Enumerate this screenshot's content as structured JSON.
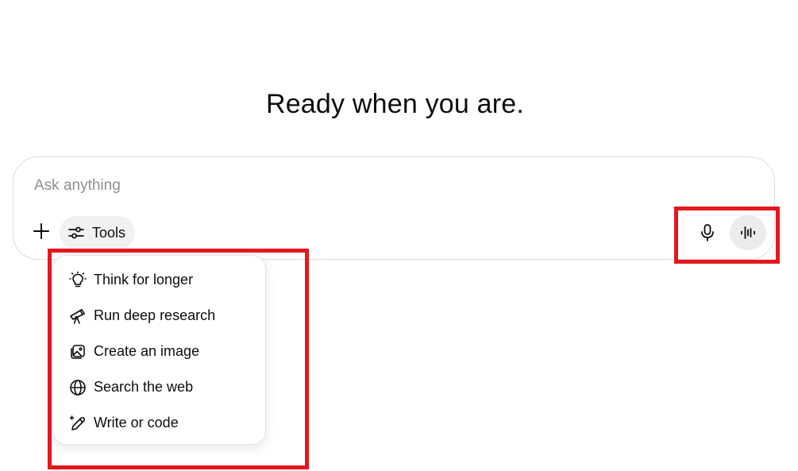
{
  "heading": "Ready when you are.",
  "composer": {
    "placeholder": "Ask anything",
    "value": "",
    "tools_label": "Tools"
  },
  "tools_menu": {
    "items": [
      {
        "label": "Think for longer",
        "icon": "lightbulb-icon"
      },
      {
        "label": "Run deep research",
        "icon": "telescope-icon"
      },
      {
        "label": "Create an image",
        "icon": "image-icon"
      },
      {
        "label": "Search the web",
        "icon": "globe-icon"
      },
      {
        "label": "Write or code",
        "icon": "pencil-sparkle-icon"
      }
    ]
  },
  "colors": {
    "highlight": "#e3181d",
    "text": "#0d0d0d",
    "placeholder": "#8f8f8f",
    "chip_background": "#f1f1f1"
  }
}
